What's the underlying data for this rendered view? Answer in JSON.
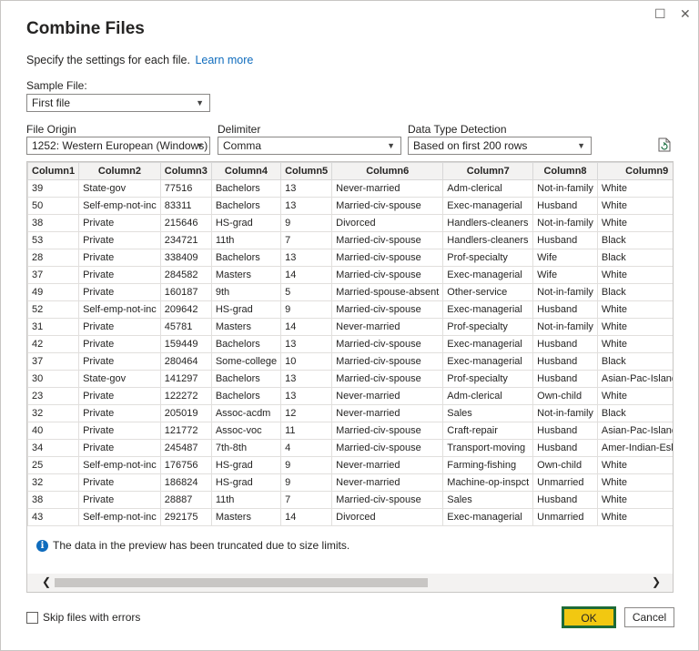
{
  "window": {
    "maximize_glyph": "☐",
    "close_glyph": "✕"
  },
  "title": "Combine Files",
  "subtitle": {
    "text": "Specify the settings for each file.",
    "link": "Learn more"
  },
  "sample_file": {
    "label": "Sample File:",
    "value": "First file"
  },
  "file_origin": {
    "label": "File Origin",
    "value": "1252: Western European (Windows)"
  },
  "delimiter": {
    "label": "Delimiter",
    "value": "Comma"
  },
  "type_detection": {
    "label": "Data Type Detection",
    "value": "Based on first 200 rows"
  },
  "grid": {
    "columns": [
      "Column1",
      "Column2",
      "Column3",
      "Column4",
      "Column5",
      "Column6",
      "Column7",
      "Column8",
      "Column9"
    ],
    "rows": [
      [
        "39",
        "State-gov",
        "77516",
        "Bachelors",
        "13",
        "Never-married",
        "Adm-clerical",
        "Not-in-family",
        "White"
      ],
      [
        "50",
        "Self-emp-not-inc",
        "83311",
        "Bachelors",
        "13",
        "Married-civ-spouse",
        "Exec-managerial",
        "Husband",
        "White"
      ],
      [
        "38",
        "Private",
        "215646",
        "HS-grad",
        "9",
        "Divorced",
        "Handlers-cleaners",
        "Not-in-family",
        "White"
      ],
      [
        "53",
        "Private",
        "234721",
        "11th",
        "7",
        "Married-civ-spouse",
        "Handlers-cleaners",
        "Husband",
        "Black"
      ],
      [
        "28",
        "Private",
        "338409",
        "Bachelors",
        "13",
        "Married-civ-spouse",
        "Prof-specialty",
        "Wife",
        "Black"
      ],
      [
        "37",
        "Private",
        "284582",
        "Masters",
        "14",
        "Married-civ-spouse",
        "Exec-managerial",
        "Wife",
        "White"
      ],
      [
        "49",
        "Private",
        "160187",
        "9th",
        "5",
        "Married-spouse-absent",
        "Other-service",
        "Not-in-family",
        "Black"
      ],
      [
        "52",
        "Self-emp-not-inc",
        "209642",
        "HS-grad",
        "9",
        "Married-civ-spouse",
        "Exec-managerial",
        "Husband",
        "White"
      ],
      [
        "31",
        "Private",
        "45781",
        "Masters",
        "14",
        "Never-married",
        "Prof-specialty",
        "Not-in-family",
        "White"
      ],
      [
        "42",
        "Private",
        "159449",
        "Bachelors",
        "13",
        "Married-civ-spouse",
        "Exec-managerial",
        "Husband",
        "White"
      ],
      [
        "37",
        "Private",
        "280464",
        "Some-college",
        "10",
        "Married-civ-spouse",
        "Exec-managerial",
        "Husband",
        "Black"
      ],
      [
        "30",
        "State-gov",
        "141297",
        "Bachelors",
        "13",
        "Married-civ-spouse",
        "Prof-specialty",
        "Husband",
        "Asian-Pac-Islander"
      ],
      [
        "23",
        "Private",
        "122272",
        "Bachelors",
        "13",
        "Never-married",
        "Adm-clerical",
        "Own-child",
        "White"
      ],
      [
        "32",
        "Private",
        "205019",
        "Assoc-acdm",
        "12",
        "Never-married",
        "Sales",
        "Not-in-family",
        "Black"
      ],
      [
        "40",
        "Private",
        "121772",
        "Assoc-voc",
        "11",
        "Married-civ-spouse",
        "Craft-repair",
        "Husband",
        "Asian-Pac-Islander"
      ],
      [
        "34",
        "Private",
        "245487",
        "7th-8th",
        "4",
        "Married-civ-spouse",
        "Transport-moving",
        "Husband",
        "Amer-Indian-Eskimo"
      ],
      [
        "25",
        "Self-emp-not-inc",
        "176756",
        "HS-grad",
        "9",
        "Never-married",
        "Farming-fishing",
        "Own-child",
        "White"
      ],
      [
        "32",
        "Private",
        "186824",
        "HS-grad",
        "9",
        "Never-married",
        "Machine-op-inspct",
        "Unmarried",
        "White"
      ],
      [
        "38",
        "Private",
        "28887",
        "11th",
        "7",
        "Married-civ-spouse",
        "Sales",
        "Husband",
        "White"
      ],
      [
        "43",
        "Self-emp-not-inc",
        "292175",
        "Masters",
        "14",
        "Divorced",
        "Exec-managerial",
        "Unmarried",
        "White"
      ]
    ],
    "notice": "The data in the preview has been truncated due to size limits."
  },
  "skip_errors": "Skip files with errors",
  "buttons": {
    "ok": "OK",
    "cancel": "Cancel"
  },
  "colors": {
    "ok_bg": "#f2c811",
    "ok_border": "#1e6b37",
    "link": "#0f6cbd"
  }
}
